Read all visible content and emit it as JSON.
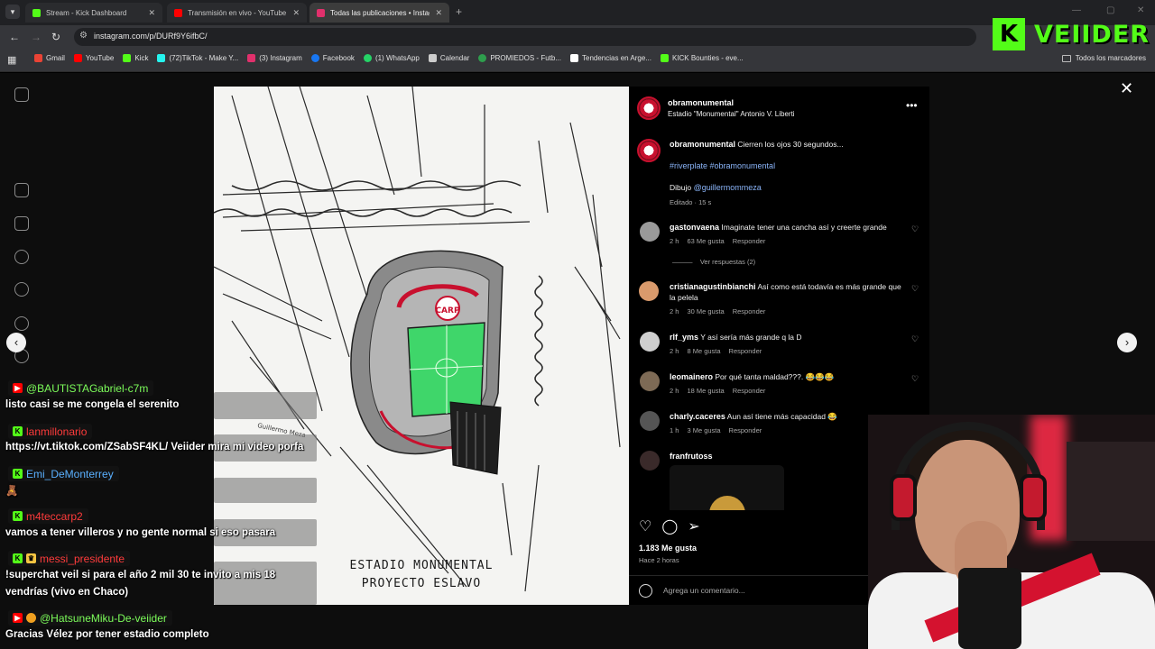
{
  "browser": {
    "tabs": [
      {
        "title": "Stream - Kick Dashboard",
        "fav_color": "#53fc18",
        "active": false
      },
      {
        "title": "Transmisión en vivo - YouTube",
        "fav_color": "#ff0000",
        "active": false
      },
      {
        "title": "Todas las publicaciones • Instag",
        "fav_color": "#e1306c",
        "active": true
      }
    ],
    "url": "instagram.com/p/DURf9Y6ifbC/",
    "bookmarks": [
      {
        "label": "Gmail",
        "color": "#ea4335"
      },
      {
        "label": "YouTube",
        "color": "#ff0000"
      },
      {
        "label": "Kick",
        "color": "#53fc18"
      },
      {
        "label": "(72)TikTok - Make Y...",
        "color": "#25f4ee"
      },
      {
        "label": "(3) Instagram",
        "color": "#e1306c"
      },
      {
        "label": "Facebook",
        "color": "#1877f2"
      },
      {
        "label": "(1) WhatsApp",
        "color": "#25d366"
      },
      {
        "label": "Calendar",
        "color": "#cccccc"
      },
      {
        "label": "PROMIEDOS - Futb...",
        "color": "#2e9e4d"
      },
      {
        "label": "Tendencias en Arge...",
        "color": "#ffffff"
      },
      {
        "label": "KICK Bounties - eve...",
        "color": "#53fc18"
      }
    ],
    "bookmarks_folder": "Todos los marcadores"
  },
  "kick_logo": {
    "letter": "K",
    "word": "VEIIDER"
  },
  "post": {
    "account": "obramonumental",
    "location": "Estadio \"Monumental\" Antonio V. Liberti",
    "caption_user": "obramonumental",
    "caption_text": "Cierren los ojos 30 segundos...",
    "hashtags": "#riverplate #obramonumental",
    "drawing_label": "Dibujo",
    "drawing_mention": "@guillermommeza",
    "edited": "Editado · 15 s",
    "artwork_line1": "ESTADIO MONUMENTAL",
    "artwork_line2": "PROYECTO ESLAVO",
    "artwork_badge": "CARP",
    "artwork_signature": "Guillermo Meza",
    "likes": "1.183 Me gusta",
    "posted": "Hace 2 horas",
    "add_comment_placeholder": "Agrega un comentario...",
    "comments": [
      {
        "user": "gastonvaena",
        "text": "Imaginate tener una cancha así y creerte grande",
        "time": "2 h",
        "likes": "63 Me gusta",
        "reply": "Responder",
        "view_replies": "Ver respuestas (2)"
      },
      {
        "user": "cristianagustinbianchi",
        "text": "Así como está todavía es más grande que la pelela",
        "time": "2 h",
        "likes": "30 Me gusta",
        "reply": "Responder"
      },
      {
        "user": "rlf_yms",
        "text": "Y así sería más grande q la D",
        "time": "2 h",
        "likes": "8 Me gusta",
        "reply": "Responder"
      },
      {
        "user": "leomainero",
        "text": "Por qué tanta maldad???. 😂😂😂",
        "time": "2 h",
        "likes": "18 Me gusta",
        "reply": "Responder"
      },
      {
        "user": "charly.caceres",
        "text": "Aun así tiene más capacidad 😂",
        "time": "1 h",
        "likes": "3 Me gusta",
        "reply": "Responder"
      },
      {
        "user": "franfrutoss",
        "text": "",
        "time": "",
        "likes": "",
        "reply": ""
      }
    ]
  },
  "chat": [
    {
      "user": "@BAUTISTAGabriel-c7m",
      "platform": "yt",
      "user_color": "#7cfc5a",
      "message": "listo casi se me congela el serenito"
    },
    {
      "user": "lanmillonario",
      "platform": "kick",
      "user_color": "#ff3b3b",
      "message": "https://vt.tiktok.com/ZSabSF4KL/ Veiider mira mi video porfa"
    },
    {
      "user": "Emi_DeMonterrey",
      "platform": "kick",
      "user_color": "#5ab0ff",
      "message": "🧸"
    },
    {
      "user": "m4teccarp2",
      "platform": "kick",
      "user_color": "#ff3b3b",
      "message": "vamos a tener villeros y no gente normal si eso pasara"
    },
    {
      "user": "messi_presidente",
      "platform": "kick",
      "user_color": "#ff3b3b",
      "message": "!superchat veil si para el año 2 mil 30 te invito a mis 18"
    },
    {
      "user": "",
      "platform": "",
      "user_color": "",
      "message": "vendrías (vivo en Chaco)"
    },
    {
      "user": "@HatsuneMiku-De-veiider",
      "platform": "yt",
      "user_color": "#7cfc5a",
      "message": "Gracias Vélez por tener estadio completo"
    }
  ]
}
